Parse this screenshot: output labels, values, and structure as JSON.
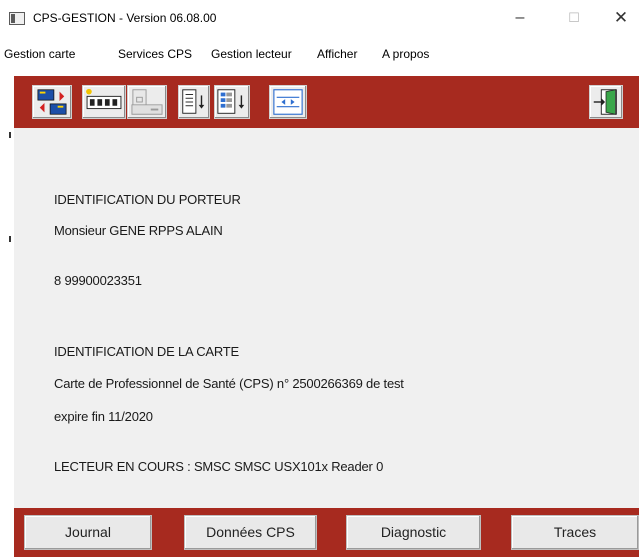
{
  "window": {
    "title": "CPS-GESTION - Version 06.08.00",
    "minimize_glyph": "–",
    "maximize_glyph": "☐",
    "close_glyph": "✕"
  },
  "menu": [
    {
      "label": "Gestion carte"
    },
    {
      "label": "Services CPS"
    },
    {
      "label": "Gestion lecteur"
    },
    {
      "label": "Afficher"
    },
    {
      "label": "A propos"
    }
  ],
  "toolbar": {
    "background_color": "#a72a1f",
    "tools": [
      {
        "icon": "card-transfer-icon"
      },
      {
        "icon": "pin-code-icon"
      },
      {
        "icon": "card-reader-icon"
      },
      {
        "icon": "document-download-icon"
      },
      {
        "icon": "list-download-icon"
      },
      {
        "icon": "settings-panel-icon"
      },
      {
        "icon": "exit-door-icon"
      }
    ]
  },
  "content": {
    "holder_heading": "IDENTIFICATION DU PORTEUR",
    "holder_name": "Monsieur GENE RPPS ALAIN",
    "holder_id": "8 99900023351",
    "card_heading": "IDENTIFICATION DE LA CARTE",
    "card_description": "Carte de Professionnel de Santé (CPS) n° 2500266369 de test",
    "card_expiry": "expire fin 11/2020",
    "reader_status": "LECTEUR EN COURS : SMSC SMSC USX101x Reader  0"
  },
  "buttons": {
    "journal": "Journal",
    "donnees_cps": "Données CPS",
    "diagnostic": "Diagnostic",
    "traces": "Traces"
  }
}
